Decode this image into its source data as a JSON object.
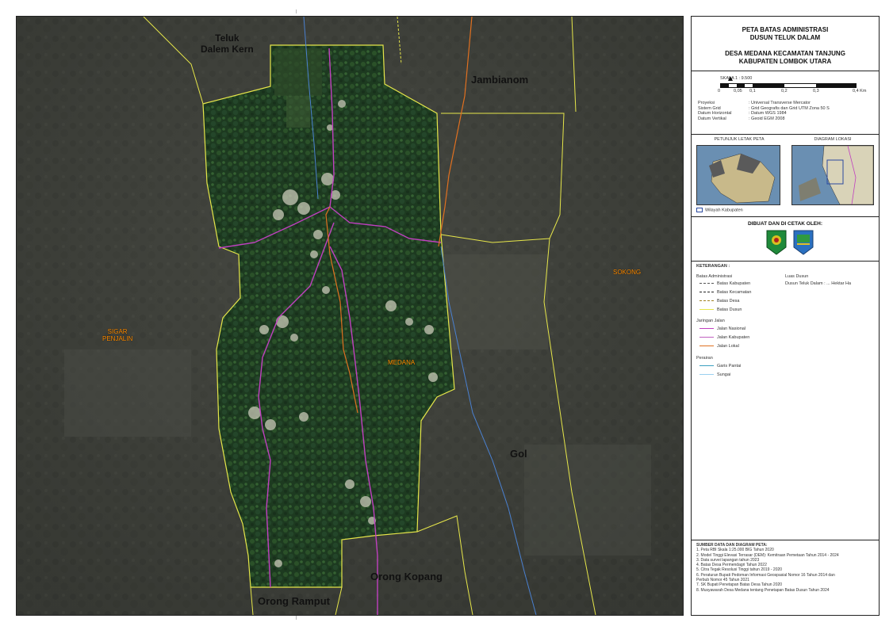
{
  "map": {
    "places": {
      "teluk_dalem_kern": "Teluk\nDalem Kern",
      "jambianom": "Jambianom",
      "gol": "Gol",
      "orong_kopang": "Orong Kopang",
      "orong_ramput": "Orong Ramput",
      "medana": "MEDANA",
      "sigar_penjalin": "SIGAR\nPENJALIN",
      "sokong": "SOKONG"
    },
    "colors": {
      "dusun_boundary": "#e6e64a",
      "national_road": "#c040c0",
      "district_road": "#e07020",
      "river": "#4a80d0",
      "vegetation": "#1f3a22"
    }
  },
  "panel": {
    "title": "PETA BATAS ADMINISTRASI\nDUSUN TELUK DALAM",
    "subtitle": "DESA MEDANA KECAMATAN TANJUNG\nKABUPATEN LOMBOK UTARA",
    "scale": {
      "label": "SKALA 1 : 9.500",
      "ticks": [
        "0",
        "0,05",
        "0,1",
        "0,2",
        "0,3",
        "0,4 Km"
      ]
    },
    "projection": [
      {
        "k": "Proyeksi",
        "v": ": Universal Transverse Mercator"
      },
      {
        "k": "Sistem Grid",
        "v": ": Grid Geografis dan Grid UTM Zona 50 S"
      },
      {
        "k": "Datum Horizontal",
        "v": ": Datum WGS 1984"
      },
      {
        "k": "Datum Vertikal",
        "v": ": Geoid EGM 2008"
      }
    ],
    "inset_left_title": "PETUNJUK LETAK PETA",
    "inset_right_title": "DIAGRAM LOKASI",
    "inset_legend": "Wilayah Kabupaten",
    "made_by_title": "DIBUAT DAN DI CETAK OLEH:",
    "legend": {
      "title": "KETERANGAN :",
      "admin_title": "Batas Administrasi",
      "admin_items": [
        "Batas Kabupaten",
        "Batas Kecamatan",
        "Batas Desa",
        "Batas Dusun"
      ],
      "area_title": "Luas Dusun",
      "area_value": "Dusun Teluk Dalam : ... Hektar Ha",
      "road_title": "Jaringan Jalan",
      "road_items": [
        "Jalan Nasional",
        "Jalan Kabupaten",
        "Jalan Lokal"
      ],
      "water_title": "Perairan",
      "water_items": [
        "Garis Pantai",
        "Sungai"
      ]
    },
    "sources_title": "SUMBER DATA DAN DIAGRAM PETA:",
    "sources": [
      "1. Peta RBI Skala 1:25.000 BIG Tahun 2020",
      "2. Model Tinggi Elevasi Terrasar (DEM): Kemitraan Pemetaan Tahun 2014 - 2024",
      "3. Data survei lapangan tahun 2023",
      "4. Batas Desa Permendagri Tahun 2022",
      "5. Citra Tegak Resolusi Tinggi tahun 2019 - 2020",
      "6. Peraturan Bupati Pedoman Informasi Geospasial Nomor 16 Tahun 2014 dan",
      "   Perbub Nomor 45 Tahun 2021",
      "7. SK Bupati Penetapan Batas Desa Tahun 2020",
      "8. Musyawarah Desa Medana tentang Penetapan Batas Dusun Tahun 2024"
    ]
  }
}
